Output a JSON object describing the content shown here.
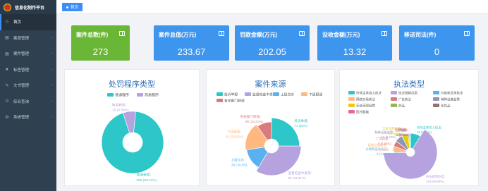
{
  "app": {
    "title": "信息化制作平台"
  },
  "sidebar": {
    "items": [
      {
        "label": "首页",
        "icon": "home-icon",
        "glyph": "⌂",
        "active": true
      },
      {
        "label": "案源管理",
        "icon": "folder-icon",
        "glyph": "▤"
      },
      {
        "label": "案件管理",
        "icon": "folder-icon",
        "glyph": "▤"
      },
      {
        "label": "标签管理",
        "icon": "star-icon",
        "glyph": "★"
      },
      {
        "label": "文书管理",
        "icon": "document-icon",
        "glyph": "✎"
      },
      {
        "label": "综合查询",
        "icon": "search-icon",
        "glyph": "⊙"
      },
      {
        "label": "系统管理",
        "icon": "gear-icon",
        "glyph": "⚙"
      }
    ]
  },
  "topbar": {
    "home_tab": "首页"
  },
  "stats": {
    "cases": {
      "label": "案件总数(件)",
      "value": "273"
    },
    "value_total": {
      "label": "案件总值(万元)",
      "value": "233.67"
    },
    "fine": {
      "label": "罚款金额(万元)",
      "value": "202.05"
    },
    "confiscation": {
      "label": "没收金额(万元)",
      "value": "13.32"
    },
    "transfer": {
      "label": "移送司法(件)",
      "value": "0"
    }
  },
  "colors": {
    "sidebar_bg": "#2f4050",
    "accent": "#3e8ef7",
    "green_card": "#6ab636",
    "blue_card": "#3e95ee",
    "title": "#2a6db5"
  },
  "chart_data": [
    {
      "type": "pie",
      "title": "处罚程序类型",
      "legend": [
        "普通程序",
        "简易程序"
      ],
      "series": [
        {
          "name": "普通程序",
          "value": 255,
          "pct": "93.41%",
          "color": "#2ec7c9"
        },
        {
          "name": "简易程序",
          "value": 18,
          "pct": "6.59%",
          "color": "#b6a2de"
        }
      ]
    },
    {
      "type": "pie",
      "title": "案件来源",
      "legend": [
        "投诉举报",
        "监督检查中发现",
        "上级交办",
        "下级报请",
        "有关部门移送"
      ],
      "series": [
        {
          "name": "投诉举报",
          "value": 71,
          "pct": "26%",
          "color": "#2ec7c9"
        },
        {
          "name": "监督检查中发现",
          "value": 95,
          "pct": "44.81%",
          "color": "#b6a2de"
        },
        {
          "name": "上级交办",
          "value": 39,
          "pct": "18.4%",
          "color": "#5ab1ef"
        },
        {
          "name": "下级报请",
          "value": 50,
          "pct": "23.58%",
          "color": "#ffb980"
        },
        {
          "name": "有关部门移送",
          "value": 28,
          "pct": "13.21%",
          "color": "#d87a80"
        }
      ]
    },
    {
      "type": "pie",
      "title": "执法类型",
      "legend": [
        "市场主体准入执法",
        "执法规制办案",
        "价格和竞争执法",
        "网络交易执法",
        "广告执法",
        "特种设备监管",
        "无证无照经营",
        "药品",
        "化妆品",
        "医疗器械"
      ],
      "series": [
        {
          "name": "市场主体准入执法",
          "value": 16,
          "pct": "6.99%",
          "color": "#2ec7c9"
        },
        {
          "name": "执法规制办案",
          "value": 119,
          "pct": "66.85%",
          "color": "#b6a2de"
        },
        {
          "name": "价格和竞争执法",
          "value": 3,
          "pct": "1.68%",
          "color": "#5ab1ef"
        },
        {
          "name": "网络交易执法",
          "value": 8,
          "pct": "4.49%",
          "color": "#ffb980"
        },
        {
          "name": "广告执法",
          "value": 9,
          "pct": "5.06%",
          "color": "#d87a80"
        },
        {
          "name": "特种设备监管",
          "value": 12,
          "pct": "6.74%",
          "color": "#8d98b3"
        },
        {
          "name": "无证无照经营",
          "value": 10,
          "pct": "5.62%",
          "color": "#e5cf0d"
        },
        {
          "name": "药品",
          "value": 2,
          "pct": "1.12%",
          "color": "#97b552"
        },
        {
          "name": "化妆品",
          "value": 1,
          "pct": "0.56%",
          "color": "#95706d"
        },
        {
          "name": "医疗器械",
          "value": 1,
          "pct": "0.56%",
          "color": "#dc69aa"
        }
      ]
    }
  ]
}
